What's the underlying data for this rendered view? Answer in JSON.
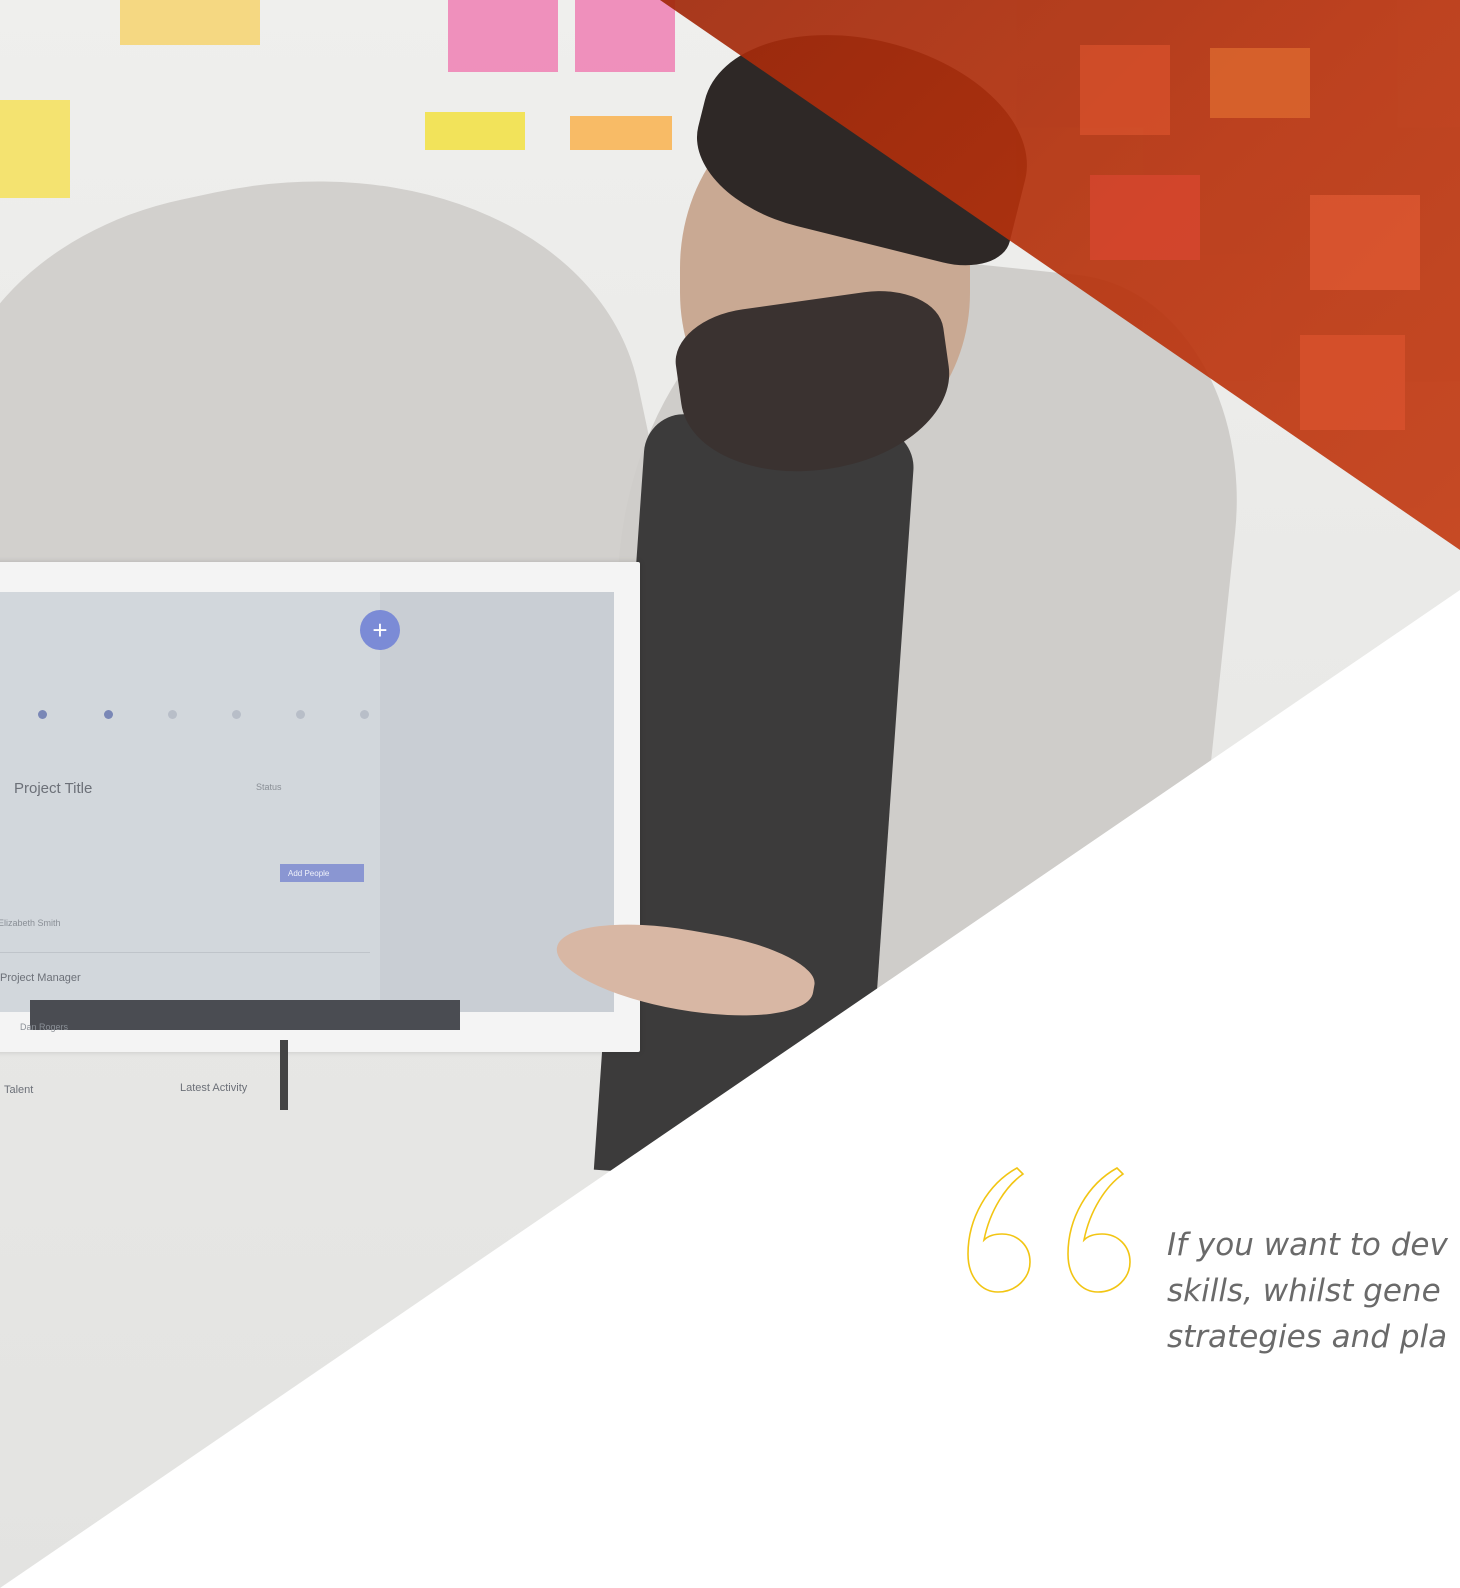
{
  "quote": {
    "lines": [
      "If you want to dev",
      "skills, whilst gene",
      "strategies and pla"
    ],
    "accent_color": "#f2c513",
    "icon": "quote-icon"
  },
  "photo": {
    "overlay_color": "#c13a12"
  },
  "app_screen": {
    "project_title": "Project Title",
    "status_label": "Status",
    "add_people_button": "Add People",
    "person_name": "Elizabeth Smith",
    "section_project_manager": "Project Manager",
    "manager_name": "Dan Rogers",
    "section_talent": "Talent",
    "section_latest_activity": "Latest Activity",
    "fab_icon": "plus-icon",
    "fab_label": "+"
  }
}
